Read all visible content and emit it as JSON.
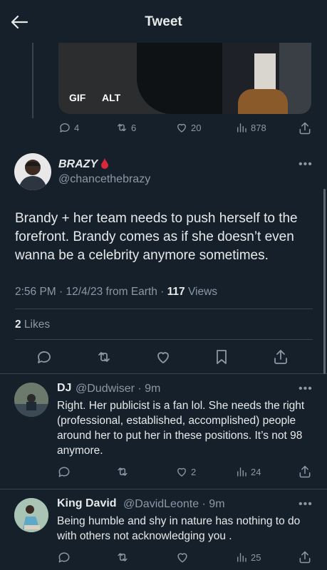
{
  "header": {
    "title": "Tweet"
  },
  "media": {
    "gif_label": "GIF",
    "alt_label": "ALT"
  },
  "parent_stats": {
    "replies": "4",
    "retweets": "6",
    "likes": "20",
    "views": "878"
  },
  "tweet": {
    "display_name": "BRAZY",
    "handle": "@chancethebrazy",
    "text": "Brandy + her team needs to push herself to the forefront. Brandy comes as if she doesn’t even wanna be a celebrity anymore sometimes.",
    "time": "2:56 PM · 12/4/23 from Earth · ",
    "views_count": "117",
    "views_label": " Views",
    "likes_count": "2",
    "likes_label": " Likes"
  },
  "replies": [
    {
      "name": "DJ",
      "handle": "@Dudwiser · 9m",
      "text": "Right. Her publicist is a fan lol. She needs the right (professional, established, accomplished) people around her to put her in these positions. It’s not 98 anymore.",
      "likes": "2",
      "views": "24"
    },
    {
      "name": "King David",
      "handle": "@DavidLeonte · 9m",
      "text": "Being humble and shy in nature has nothing to do with others not acknowledging you .",
      "likes": "",
      "views": "25"
    }
  ],
  "colors": {
    "background": "#15202b",
    "text": "#e7e9ea",
    "muted": "#8b98a5",
    "divider": "#38444d"
  }
}
